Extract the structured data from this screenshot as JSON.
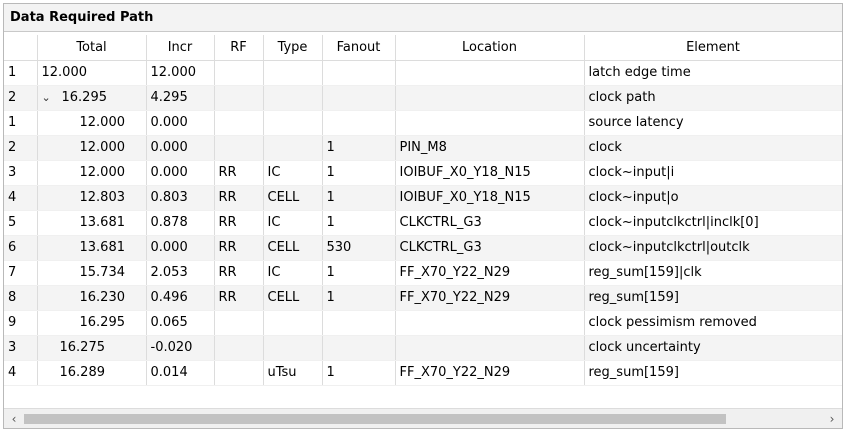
{
  "panel": {
    "title": "Data Required Path"
  },
  "table": {
    "columns": [
      "",
      "Total",
      "Incr",
      "RF",
      "Type",
      "Fanout",
      "Location",
      "Element"
    ],
    "rows": [
      {
        "num": "1",
        "total": "12.000",
        "incr": "12.000",
        "rf": "",
        "type": "",
        "fanout": "",
        "location": "",
        "element": "latch edge time"
      },
      {
        "num": "2",
        "total": "16.295",
        "incr": "4.295",
        "rf": "",
        "type": "",
        "fanout": "",
        "location": "",
        "element": "clock path"
      },
      {
        "num": "1",
        "total": "12.000",
        "incr": "0.000",
        "rf": "",
        "type": "",
        "fanout": "",
        "location": "",
        "element": "source latency"
      },
      {
        "num": "2",
        "total": "12.000",
        "incr": "0.000",
        "rf": "",
        "type": "",
        "fanout": "1",
        "location": "PIN_M8",
        "element": "clock"
      },
      {
        "num": "3",
        "total": "12.000",
        "incr": "0.000",
        "rf": "RR",
        "type": "IC",
        "fanout": "1",
        "location": "IOIBUF_X0_Y18_N15",
        "element": "clock~input|i"
      },
      {
        "num": "4",
        "total": "12.803",
        "incr": "0.803",
        "rf": "RR",
        "type": "CELL",
        "fanout": "1",
        "location": "IOIBUF_X0_Y18_N15",
        "element": "clock~input|o"
      },
      {
        "num": "5",
        "total": "13.681",
        "incr": "0.878",
        "rf": "RR",
        "type": "IC",
        "fanout": "1",
        "location": "CLKCTRL_G3",
        "element": "clock~inputclkctrl|inclk[0]"
      },
      {
        "num": "6",
        "total": "13.681",
        "incr": "0.000",
        "rf": "RR",
        "type": "CELL",
        "fanout": "530",
        "location": "CLKCTRL_G3",
        "element": "clock~inputclkctrl|outclk"
      },
      {
        "num": "7",
        "total": "15.734",
        "incr": "2.053",
        "rf": "RR",
        "type": "IC",
        "fanout": "1",
        "location": "FF_X70_Y22_N29",
        "element": "reg_sum[159]|clk"
      },
      {
        "num": "8",
        "total": "16.230",
        "incr": "0.496",
        "rf": "RR",
        "type": "CELL",
        "fanout": "1",
        "location": "FF_X70_Y22_N29",
        "element": "reg_sum[159]"
      },
      {
        "num": "9",
        "total": "16.295",
        "incr": "0.065",
        "rf": "",
        "type": "",
        "fanout": "",
        "location": "",
        "element": "clock pessimism removed"
      },
      {
        "num": "3",
        "total": "16.275",
        "incr": "-0.020",
        "rf": "",
        "type": "",
        "fanout": "",
        "location": "",
        "element": "clock uncertainty"
      },
      {
        "num": "4",
        "total": "16.289",
        "incr": "0.014",
        "rf": "",
        "type": "uTsu",
        "fanout": "1",
        "location": "FF_X70_Y22_N29",
        "element": "reg_sum[159]"
      }
    ]
  },
  "icons": {
    "expand": "chevron-down-icon",
    "scroll_left": "chevron-left-icon",
    "scroll_right": "chevron-right-icon"
  }
}
